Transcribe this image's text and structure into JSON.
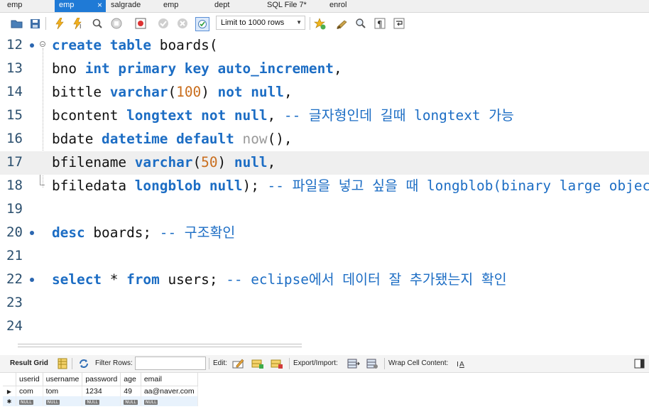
{
  "tabs": [
    {
      "label": "emp"
    },
    {
      "label": "emp",
      "close": "×"
    },
    {
      "label": "salgrade"
    },
    {
      "label": "emp"
    },
    {
      "label": "dept"
    },
    {
      "label": "SQL File 7*"
    },
    {
      "label": "enrol"
    }
  ],
  "toolbar": {
    "limit_value": "Limit to 1000 rows",
    "limit_arrow": "▼"
  },
  "editor": {
    "line_numbers": [
      "12",
      "13",
      "14",
      "15",
      "16",
      "17",
      "18",
      "19",
      "20",
      "21",
      "22",
      "23",
      "24"
    ],
    "lines": {
      "l12": {
        "kw1": "create table",
        "rest": " boards("
      },
      "l13": {
        "a": "bno ",
        "kw1": "int primary key auto_increment",
        "b": ","
      },
      "l14": {
        "a": "bittle ",
        "kw1": "varchar",
        "b": "(",
        "num": "100",
        "c": ") ",
        "kw2": "not null",
        "d": ","
      },
      "l15": {
        "a": "bcontent ",
        "kw1": "longtext not null",
        "b": ", ",
        "cmt": "-- 글자형인데 길때 longtext 가능"
      },
      "l16": {
        "a": "bdate ",
        "kw1": "datetime default",
        "b": " ",
        "fn": "now",
        "c": "(),"
      },
      "l17": {
        "a": "bfilename ",
        "kw1": "varchar",
        "b": "(",
        "num": "50",
        "c": ") ",
        "kw2": "null",
        "d": ","
      },
      "l18": {
        "a": "bfiledata ",
        "kw1": "longblob null",
        "b": "); ",
        "cmt": "-- 파일을 넣고 싶을 때 longblob(binary large object)"
      },
      "l20": {
        "kw1": "desc",
        "a": " boards; ",
        "cmt": "-- 구조확인"
      },
      "l22": {
        "kw1": "select",
        "a": " * ",
        "kw2": "from",
        "b": " users; ",
        "cmt": "-- eclipse에서 데이터 잘 추가됐는지 확인"
      }
    }
  },
  "result_toolbar": {
    "result_grid": "Result Grid",
    "filter_rows": "Filter Rows:",
    "edit": "Edit:",
    "export_import": "Export/Import:",
    "wrap_cell": "Wrap Cell Content:"
  },
  "grid": {
    "columns": [
      "userid",
      "username",
      "password",
      "age",
      "email"
    ],
    "rows": [
      [
        "com",
        "tom",
        "1234",
        "49",
        "aa@naver.com"
      ]
    ],
    "null_label": "NULL",
    "row_marker": "▶",
    "new_marker": "✱"
  },
  "colors": {
    "active_tab": "#1f7ad6",
    "keyword": "#1c6dc4",
    "number": "#c96d1c",
    "current_line": "#efefef"
  }
}
